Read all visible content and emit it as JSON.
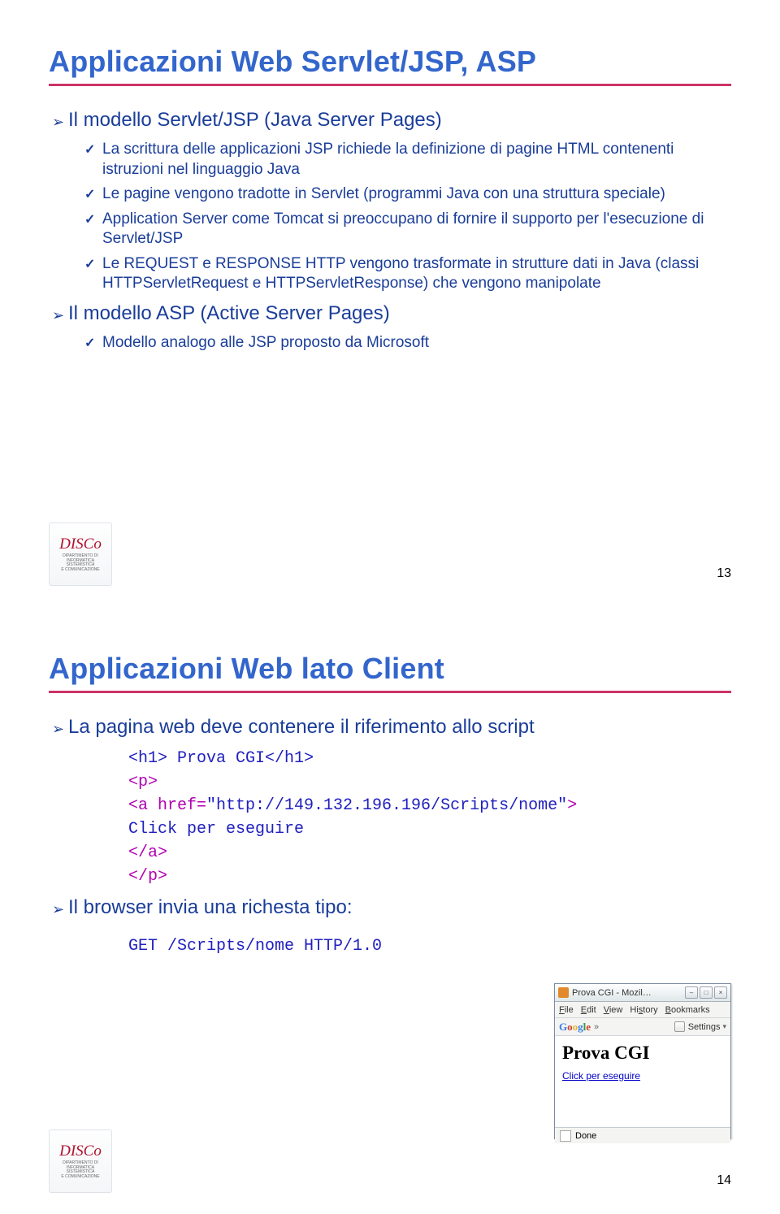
{
  "slide1": {
    "title": "Applicazioni Web Servlet/JSP, ASP",
    "b1": "Il modello Servlet/JSP (Java Server Pages)",
    "b1_1": "La scrittura delle applicazioni JSP richiede la definizione di pagine HTML contenenti istruzioni nel linguaggio Java",
    "b1_2": "Le pagine vengono tradotte in Servlet (programmi Java con una struttura speciale)",
    "b1_3": "Application Server come Tomcat si preoccupano di fornire il supporto per l'esecuzione di Servlet/JSP",
    "b1_4": "Le REQUEST e RESPONSE HTTP vengono trasformate in strutture dati in Java (classi HTTPServletRequest e HTTPServletResponse) che vengono manipolate",
    "b2": "Il modello ASP (Active Server Pages)",
    "b2_1": "Modello analogo alle JSP proposto da Microsoft",
    "pagenum": "13"
  },
  "slide2": {
    "title": "Applicazioni Web lato Client",
    "b1": "La pagina web deve contenere il riferimento allo script",
    "code_l1": "<h1> Prova CGI</h1>",
    "code_l2": "<p>",
    "code_l3a": "  <a href=",
    "code_l3b": "\"http://149.132.196.196/Scripts/nome\"",
    "code_l3c": ">",
    "code_l4": "    Click per eseguire",
    "code_l5": "  </a>",
    "code_l6": "</p>",
    "b2": "Il browser invia una richesta tipo:",
    "code2": "GET /Scripts/nome HTTP/1.0",
    "pagenum": "14"
  },
  "browser": {
    "title": "Prova CGI - Mozil…",
    "menu": {
      "file": "File",
      "edit": "Edit",
      "view": "View",
      "history": "History",
      "bookmarks": "Bookmarks"
    },
    "settings": "Settings",
    "h1": "Prova CGI",
    "link": "Click per eseguire",
    "status": "Done"
  },
  "logo": {
    "brand": "DISCo",
    "dept": "DIPARTIMENTO DI\nINFORMATICA\nSISTEMISTICA\nE COMUNICAZIONE"
  }
}
